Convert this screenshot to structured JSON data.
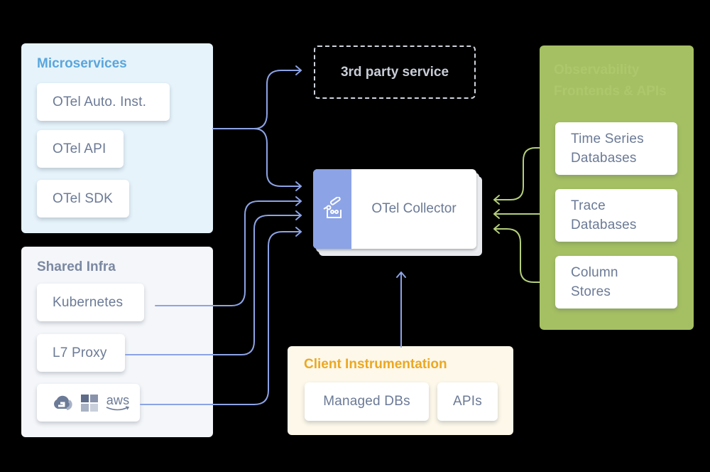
{
  "microservices": {
    "title": "Microservices",
    "items": [
      "OTel Auto. Inst.",
      "OTel API",
      "OTel SDK"
    ]
  },
  "shared_infra": {
    "title": "Shared Infra",
    "items": [
      "Kubernetes",
      "L7 Proxy"
    ],
    "cloud_icons": [
      "google-cloud-icon",
      "azure-icon",
      "aws-icon"
    ],
    "aws_label": "aws"
  },
  "third_party": {
    "label": "3rd party service"
  },
  "collector": {
    "label": "OTel Collector",
    "icon": "telescope-icon"
  },
  "client_instrumentation": {
    "title": "Client Instrumentation",
    "items": [
      "Managed DBs",
      "APIs"
    ]
  },
  "observability": {
    "title": "Observability Frontends & APIs",
    "items": [
      {
        "line1": "Time Series",
        "line2": "Databases"
      },
      {
        "line1": "Trace",
        "line2": "Databases"
      },
      {
        "line1": "Column",
        "line2": "Stores"
      }
    ]
  },
  "colors": {
    "blue_wire": "#8ca3e6",
    "green_wire": "#b5cf7a",
    "microservices_title": "#5aa6dc",
    "client_title": "#eba823",
    "observability_bg": "#a5c063"
  }
}
